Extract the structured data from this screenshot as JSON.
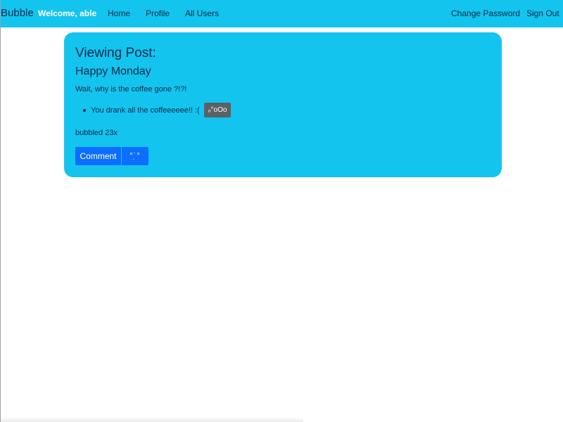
{
  "navbar": {
    "brand": "Bubble",
    "welcome": "Welcome, able",
    "links": {
      "home": "Home",
      "profile": "Profile",
      "all_users": "All Users",
      "change_password": "Change Password",
      "sign_out": "Sign Out"
    }
  },
  "post": {
    "heading": "Viewing Post:",
    "title": "Happy Monday",
    "body": "Wait, why is the coffee gone ?!?!",
    "comments": [
      {
        "text": "You drank all the coffeeeeee!! :(",
        "badge": "ₒ°oOo"
      }
    ],
    "bubbled_count": "bubbled 23x",
    "buttons": {
      "comment": "Comment",
      "bubble": "°˙̣°"
    }
  },
  "colors": {
    "accent": "#13c4ee",
    "primary_button": "#0d6efd",
    "badge": "#5c6166",
    "text": "#0b2a4a"
  }
}
